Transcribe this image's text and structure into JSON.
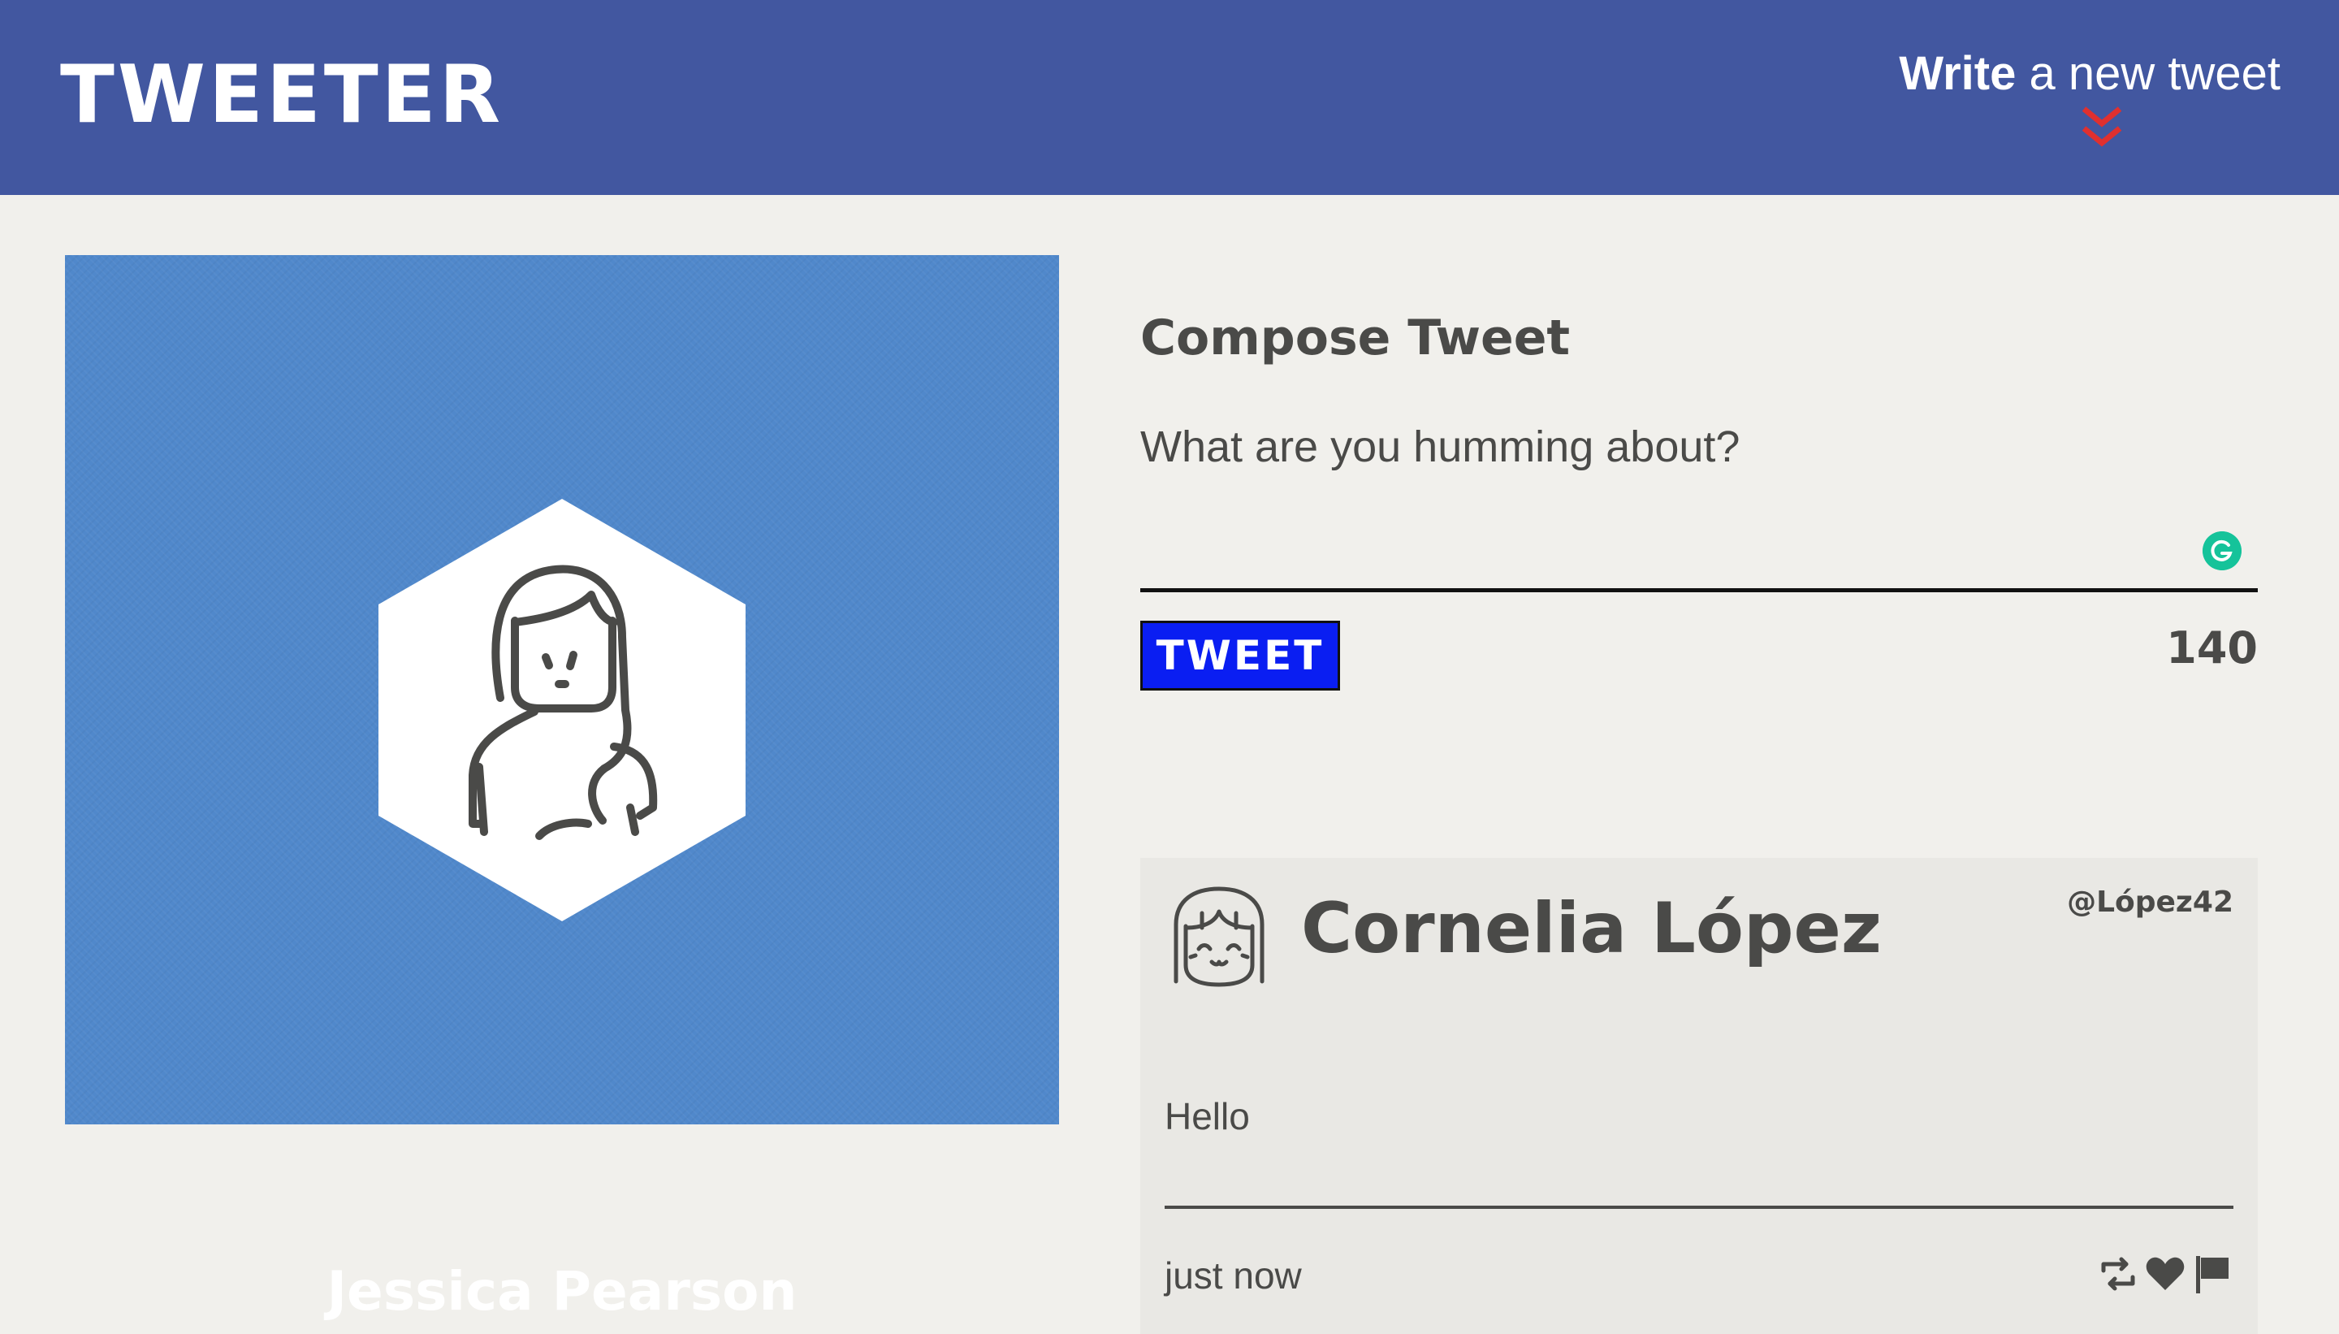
{
  "header": {
    "logo": "TWEETER",
    "write_bold": "Write",
    "write_rest": " a new tweet",
    "icons": {
      "write_chevron": "double-chevron-down-icon"
    },
    "colors": {
      "bar": "#4257a0",
      "chevron": "#e0302f"
    }
  },
  "profile": {
    "name": "Jessica Pearson",
    "avatar_icon": "woman-avatar-icon",
    "colors": {
      "card": "#5088cb"
    }
  },
  "compose": {
    "title": "Compose Tweet",
    "placeholder": "What are you humming about?",
    "value": "",
    "tweet_button": "TWEET",
    "char_count": "140",
    "icons": {
      "grammarly": "grammarly-icon"
    },
    "colors": {
      "button": "#0a1ef2"
    }
  },
  "tweets": [
    {
      "author": "Cornelia López",
      "handle": "@López42",
      "text": "Hello",
      "time": "just now",
      "avatar_icon": "smiling-girl-avatar-icon",
      "action_icons": [
        "retweet-icon",
        "heart-icon",
        "flag-icon"
      ]
    }
  ]
}
